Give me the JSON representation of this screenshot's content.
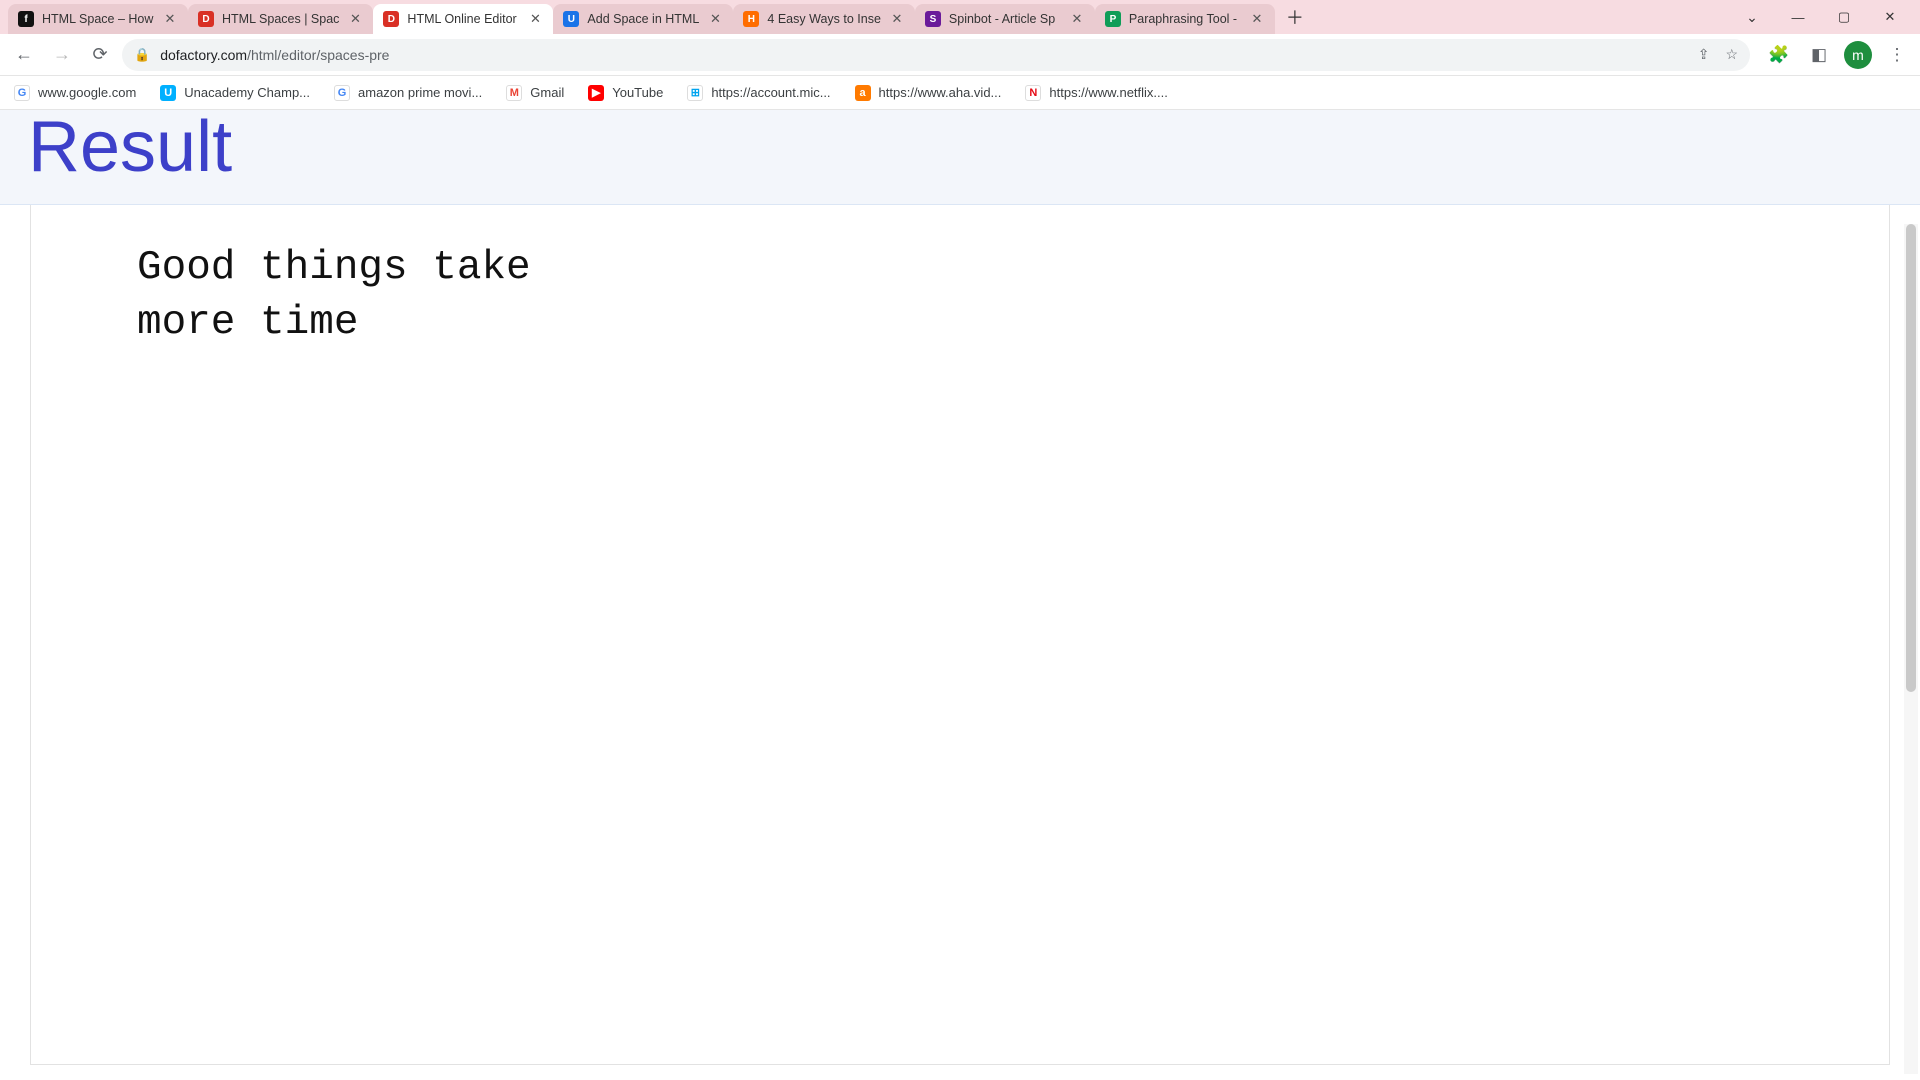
{
  "window": {
    "profile_initial": "m"
  },
  "tabs": [
    {
      "title": "HTML Space – How",
      "favicon_bg": "#111111",
      "favicon_text": "f",
      "active": false
    },
    {
      "title": "HTML Spaces | Spac",
      "favicon_bg": "#d93025",
      "favicon_text": "D",
      "active": false
    },
    {
      "title": "HTML Online Editor",
      "favicon_bg": "#d93025",
      "favicon_text": "D",
      "active": true
    },
    {
      "title": "Add Space in HTML",
      "favicon_bg": "#1a73e8",
      "favicon_text": "U",
      "active": false
    },
    {
      "title": "4 Easy Ways to Inse",
      "favicon_bg": "#ff6d00",
      "favicon_text": "H",
      "active": false
    },
    {
      "title": "Spinbot - Article Sp",
      "favicon_bg": "#6a1b9a",
      "favicon_text": "S",
      "active": false
    },
    {
      "title": "Paraphrasing Tool -",
      "favicon_bg": "#0f9d58",
      "favicon_text": "P",
      "active": false
    }
  ],
  "omnibox": {
    "host": "dofactory.com",
    "path": "/html/editor/spaces-pre"
  },
  "bookmarks": [
    {
      "label": "www.google.com",
      "icon_bg": "#ffffff",
      "icon_text": "G",
      "icon_color": "#4285f4",
      "icon_border": "1px solid #ddd"
    },
    {
      "label": "Unacademy Champ...",
      "icon_bg": "#00b0ff",
      "icon_text": "U",
      "icon_color": "#fff",
      "icon_border": "none"
    },
    {
      "label": "amazon prime movi...",
      "icon_bg": "#ffffff",
      "icon_text": "G",
      "icon_color": "#4285f4",
      "icon_border": "1px solid #ddd"
    },
    {
      "label": "Gmail",
      "icon_bg": "#ffffff",
      "icon_text": "M",
      "icon_color": "#ea4335",
      "icon_border": "1px solid #ddd"
    },
    {
      "label": "YouTube",
      "icon_bg": "#ff0000",
      "icon_text": "▶",
      "icon_color": "#fff",
      "icon_border": "none"
    },
    {
      "label": "https://account.mic...",
      "icon_bg": "#ffffff",
      "icon_text": "⊞",
      "icon_color": "#00a4ef",
      "icon_border": "1px solid #ddd"
    },
    {
      "label": "https://www.aha.vid...",
      "icon_bg": "#ff7a00",
      "icon_text": "a",
      "icon_color": "#fff",
      "icon_border": "none"
    },
    {
      "label": "https://www.netflix....",
      "icon_bg": "#ffffff",
      "icon_text": "N",
      "icon_color": "#e50914",
      "icon_border": "1px solid #ddd"
    }
  ],
  "page": {
    "heading": "Result",
    "output": "Good things take\nmore time"
  }
}
